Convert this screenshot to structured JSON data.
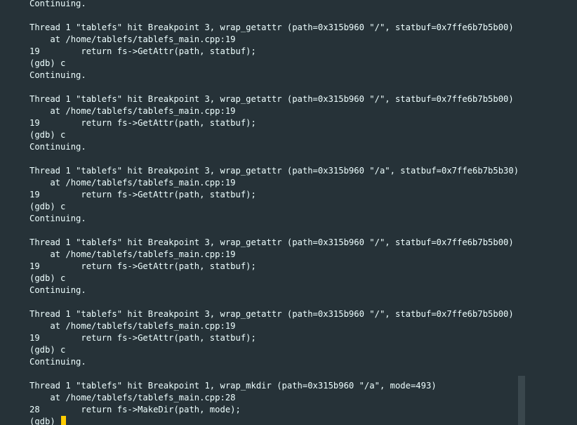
{
  "terminal": {
    "lines": [
      "Continuing.",
      "",
      "Thread 1 \"tablefs\" hit Breakpoint 3, wrap_getattr (path=0x315b960 \"/\", statbuf=0x7ffe6b7b5b00)",
      "    at /home/tablefs/tablefs_main.cpp:19",
      "19        return fs->GetAttr(path, statbuf);",
      "(gdb) c",
      "Continuing.",
      "",
      "Thread 1 \"tablefs\" hit Breakpoint 3, wrap_getattr (path=0x315b960 \"/\", statbuf=0x7ffe6b7b5b00)",
      "    at /home/tablefs/tablefs_main.cpp:19",
      "19        return fs->GetAttr(path, statbuf);",
      "(gdb) c",
      "Continuing.",
      "",
      "Thread 1 \"tablefs\" hit Breakpoint 3, wrap_getattr (path=0x315b960 \"/a\", statbuf=0x7ffe6b7b5b30)",
      "    at /home/tablefs/tablefs_main.cpp:19",
      "19        return fs->GetAttr(path, statbuf);",
      "(gdb) c",
      "Continuing.",
      "",
      "Thread 1 \"tablefs\" hit Breakpoint 3, wrap_getattr (path=0x315b960 \"/\", statbuf=0x7ffe6b7b5b00)",
      "    at /home/tablefs/tablefs_main.cpp:19",
      "19        return fs->GetAttr(path, statbuf);",
      "(gdb) c",
      "Continuing.",
      "",
      "Thread 1 \"tablefs\" hit Breakpoint 3, wrap_getattr (path=0x315b960 \"/\", statbuf=0x7ffe6b7b5b00)",
      "    at /home/tablefs/tablefs_main.cpp:19",
      "19        return fs->GetAttr(path, statbuf);",
      "(gdb) c",
      "Continuing.",
      "",
      "Thread 1 \"tablefs\" hit Breakpoint 1, wrap_mkdir (path=0x315b960 \"/a\", mode=493)",
      "    at /home/tablefs/tablefs_main.cpp:28",
      "28        return fs->MakeDir(path, mode);"
    ],
    "prompt": "(gdb) "
  },
  "colors": {
    "background": "#263238",
    "foreground": "#eeffff",
    "cursor": "#ffcc00",
    "scrollbar": "#3a474d"
  }
}
